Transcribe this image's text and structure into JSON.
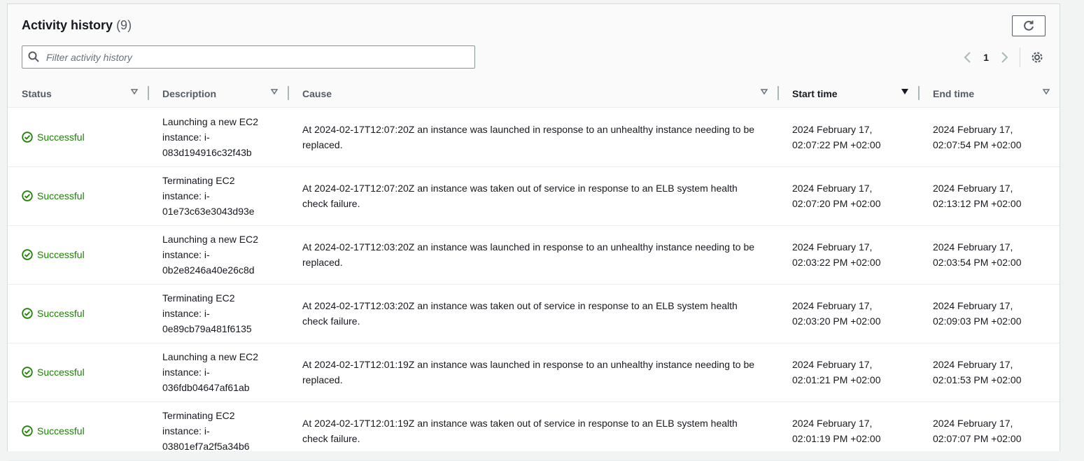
{
  "header": {
    "title": "Activity history",
    "count": "(9)",
    "filter_placeholder": "Filter activity history",
    "page": "1"
  },
  "columns": {
    "status": "Status",
    "description": "Description",
    "cause": "Cause",
    "start_time": "Start time",
    "end_time": "End time"
  },
  "colors": {
    "success": "#1d8102",
    "accent": "#16191f"
  },
  "rows": [
    {
      "status": "Successful",
      "desc": [
        "Launching a new EC2",
        "instance: i-",
        "083d194916c32f43b"
      ],
      "cause": [
        "At 2024-02-17T12:07:20Z an instance was launched in response to an unhealthy instance needing to be",
        "replaced."
      ],
      "start": [
        "2024 February 17,",
        "02:07:22 PM +02:00"
      ],
      "end": [
        "2024 February 17,",
        "02:07:54 PM +02:00"
      ]
    },
    {
      "status": "Successful",
      "desc": [
        "Terminating EC2",
        "instance: i-",
        "01e73c63e3043d93e"
      ],
      "cause": [
        "At 2024-02-17T12:07:20Z an instance was taken out of service in response to an ELB system health",
        "check failure."
      ],
      "start": [
        "2024 February 17,",
        "02:07:20 PM +02:00"
      ],
      "end": [
        "2024 February 17,",
        "02:13:12 PM +02:00"
      ]
    },
    {
      "status": "Successful",
      "desc": [
        "Launching a new EC2",
        "instance: i-",
        "0b2e8246a40e26c8d"
      ],
      "cause": [
        "At 2024-02-17T12:03:20Z an instance was launched in response to an unhealthy instance needing to be",
        "replaced."
      ],
      "start": [
        "2024 February 17,",
        "02:03:22 PM +02:00"
      ],
      "end": [
        "2024 February 17,",
        "02:03:54 PM +02:00"
      ]
    },
    {
      "status": "Successful",
      "desc": [
        "Terminating EC2",
        "instance: i-",
        "0e89cb79a481f6135"
      ],
      "cause": [
        "At 2024-02-17T12:03:20Z an instance was taken out of service in response to an ELB system health",
        "check failure."
      ],
      "start": [
        "2024 February 17,",
        "02:03:20 PM +02:00"
      ],
      "end": [
        "2024 February 17,",
        "02:09:03 PM +02:00"
      ]
    },
    {
      "status": "Successful",
      "desc": [
        "Launching a new EC2",
        "instance: i-",
        "036fdb04647af61ab"
      ],
      "cause": [
        "At 2024-02-17T12:01:19Z an instance was launched in response to an unhealthy instance needing to be",
        "replaced."
      ],
      "start": [
        "2024 February 17,",
        "02:01:21 PM +02:00"
      ],
      "end": [
        "2024 February 17,",
        "02:01:53 PM +02:00"
      ]
    },
    {
      "status": "Successful",
      "desc": [
        "Terminating EC2",
        "instance: i-",
        "03801ef7a2f5a34b6"
      ],
      "cause": [
        "At 2024-02-17T12:01:19Z an instance was taken out of service in response to an ELB system health",
        "check failure."
      ],
      "start": [
        "2024 February 17,",
        "02:01:19 PM +02:00"
      ],
      "end": [
        "2024 February 17,",
        "02:07:07 PM +02:00"
      ]
    }
  ]
}
